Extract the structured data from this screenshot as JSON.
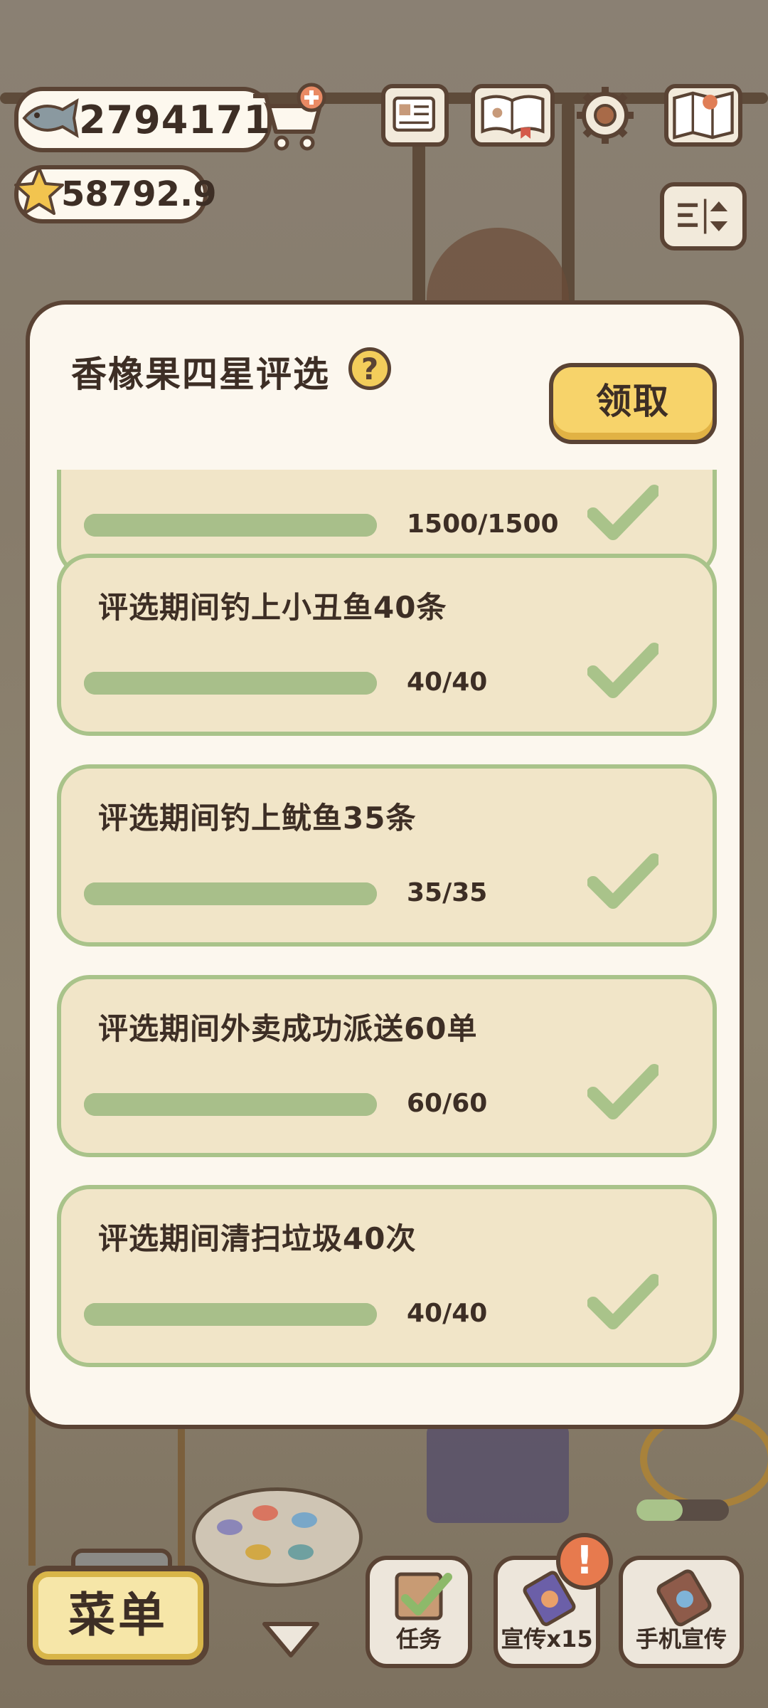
{
  "hud": {
    "fish_count": "2794171",
    "star_count": "58792.9",
    "icons": [
      "fish-icon",
      "cart-plus-icon",
      "star-icon",
      "card-icon",
      "open-book-icon",
      "gear-icon",
      "map-icon",
      "sort-icon"
    ]
  },
  "modal": {
    "title": "香橡果四星评选",
    "help_glyph": "?",
    "claim_label": "领取",
    "tasks": [
      {
        "label": "",
        "count": "1500/1500",
        "progress": 1.0,
        "done": true
      },
      {
        "label": "评选期间钓上小丑鱼40条",
        "count": "40/40",
        "progress": 1.0,
        "done": true
      },
      {
        "label": "评选期间钓上鱿鱼35条",
        "count": "35/35",
        "progress": 1.0,
        "done": true
      },
      {
        "label": "评选期间外卖成功派送60单",
        "count": "60/60",
        "progress": 1.0,
        "done": true
      },
      {
        "label": "评选期间清扫垃圾40次",
        "count": "40/40",
        "progress": 1.0,
        "done": true
      }
    ]
  },
  "bottom": {
    "menu_label": "菜单",
    "task_label": "任务",
    "promo_label": "宣传x15",
    "phone_label": "手机宣传",
    "badge_glyph": "!",
    "phone_progress": 0.5
  },
  "colors": {
    "accent_yellow": "#f7d36a",
    "card_bg": "#f1e5c8",
    "card_border": "#a9c38a",
    "check_green": "#a9c38a",
    "text_dark": "#3d2e25",
    "badge_orange": "#e77a4e"
  }
}
